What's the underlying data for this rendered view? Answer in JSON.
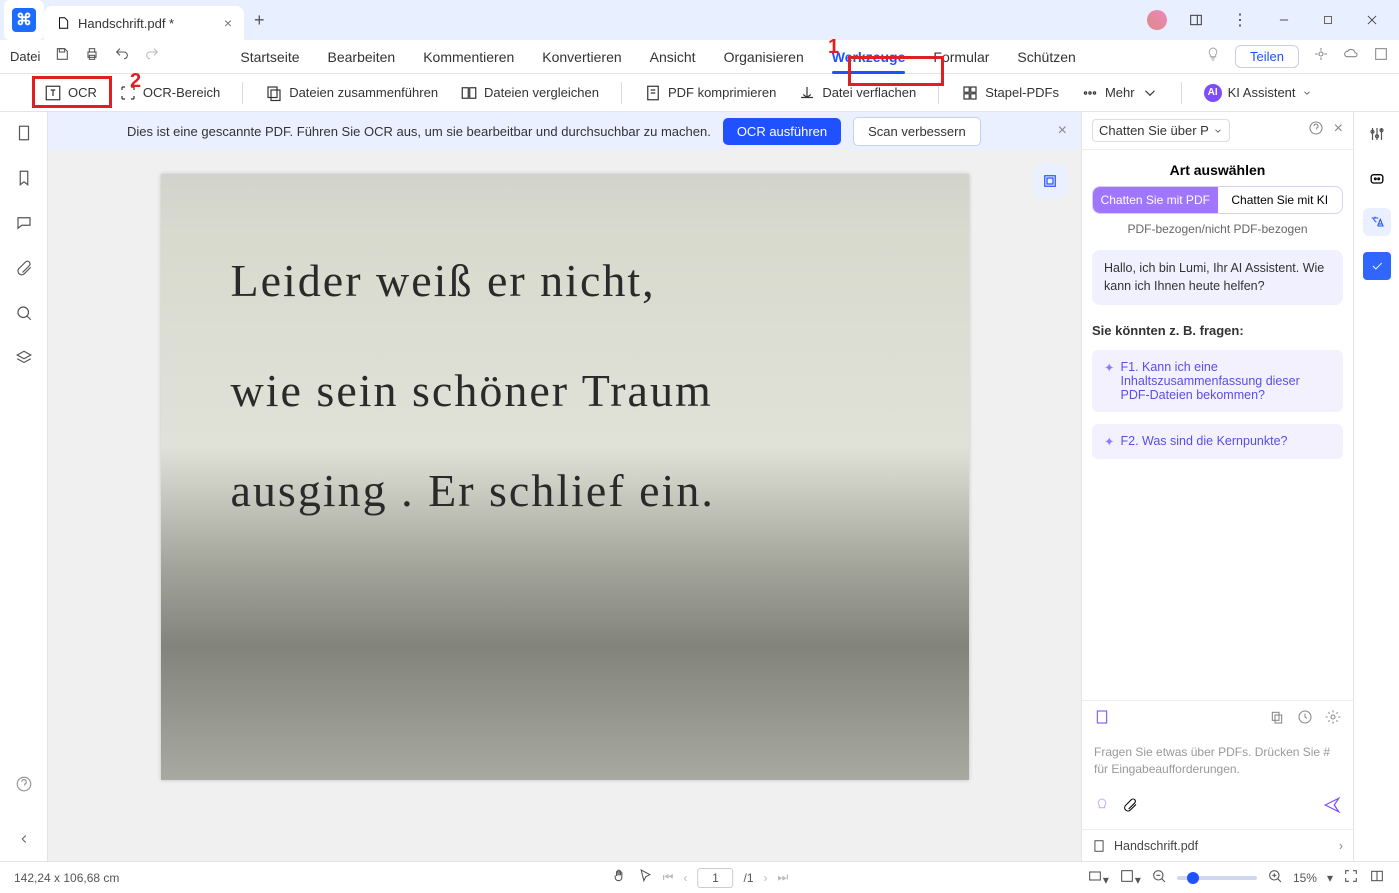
{
  "titlebar": {
    "tab_title": "Handschrift.pdf *",
    "plus": "+"
  },
  "menubar": {
    "file": "Datei",
    "tabs": [
      "Startseite",
      "Bearbeiten",
      "Kommentieren",
      "Konvertieren",
      "Ansicht",
      "Organisieren",
      "Werkzeuge",
      "Formular",
      "Schützen"
    ],
    "active_index": 6,
    "share": "Teilen"
  },
  "toolbar": {
    "ocr": "OCR",
    "ocr_area": "OCR-Bereich",
    "merge": "Dateien zusammenführen",
    "compare": "Dateien vergleichen",
    "compress": "PDF komprimieren",
    "flatten": "Datei verflachen",
    "batch": "Stapel-PDFs",
    "more": "Mehr",
    "ai": "KI Assistent"
  },
  "infobar": {
    "text": "Dies ist eine gescannte PDF. Führen Sie OCR aus, um sie bearbeitbar und durchsuchbar zu machen.",
    "run": "OCR ausführen",
    "improve": "Scan verbessern"
  },
  "handwriting": {
    "l1": "Leider weiß er nicht,",
    "l2": "wie sein schöner Traum",
    "l3": "ausging . Er schlief ein."
  },
  "ai": {
    "header_select": "Chatten Sie über P",
    "title": "Art auswählen",
    "switch_on": "Chatten Sie mit PDF",
    "switch_off": "Chatten Sie mit KI",
    "subtitle": "PDF-bezogen/nicht PDF-bezogen",
    "greeting": "Hallo, ich bin Lumi, Ihr AI Assistent. Wie kann ich Ihnen heute helfen?",
    "suggest_label": "Sie könnten z. B. fragen:",
    "q1": "F1. Kann ich eine Inhaltszusammenfassung dieser PDF-Dateien bekommen?",
    "q2": "F2. Was sind die Kernpunkte?",
    "input_hint": "Fragen Sie etwas über PDFs. Drücken Sie # für Eingabeaufforderungen.",
    "file": "Handschrift.pdf"
  },
  "status": {
    "dims": "142,24 x 106,68 cm",
    "page_cur": "1",
    "page_total": "/1",
    "zoom": "15%"
  },
  "highlights": {
    "n1": "1",
    "n2": "2"
  }
}
